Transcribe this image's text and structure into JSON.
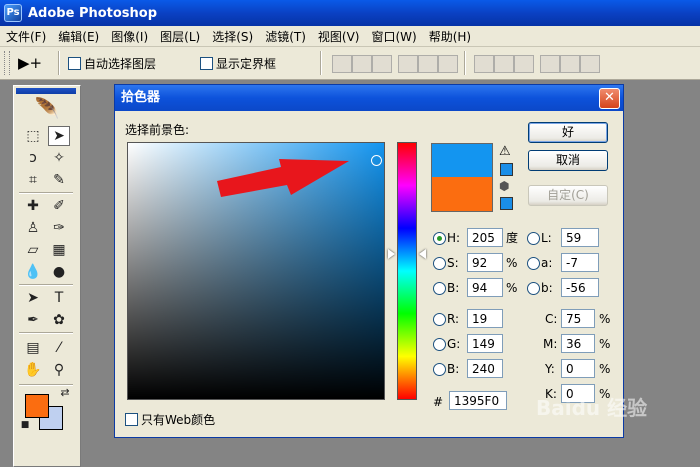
{
  "app": {
    "title": "Adobe Photoshop",
    "menu": [
      "文件(F)",
      "编辑(E)",
      "图像(I)",
      "图层(L)",
      "选择(S)",
      "滤镜(T)",
      "视图(V)",
      "窗口(W)",
      "帮助(H)"
    ]
  },
  "options_bar": {
    "tool_preset": "▶+",
    "auto_select_label": "自动选择图层",
    "show_bounds_label": "显示定界框"
  },
  "toolbox": {
    "foreground_color": "#fb6d10",
    "background_color": "#bfd0f0"
  },
  "picker": {
    "title": "拾色器",
    "close_glyph": "✕",
    "select_label": "选择前景色:",
    "ok_label": "好",
    "cancel_label": "取消",
    "custom_label": "自定(C)",
    "web_only_label": "只有Web颜色",
    "new_color": "#1395f0",
    "old_color": "#fb6d10",
    "hsb": {
      "h_label": "H:",
      "h": "205",
      "h_unit": "度",
      "s_label": "S:",
      "s": "92",
      "s_unit": "%",
      "b_label": "B:",
      "b": "94",
      "b_unit": "%"
    },
    "lab": {
      "l_label": "L:",
      "l": "59",
      "a_label": "a:",
      "a": "-7",
      "b_label": "b:",
      "b": "-56"
    },
    "rgb": {
      "r_label": "R:",
      "r": "19",
      "g_label": "G:",
      "g": "149",
      "b_label": "B:",
      "b": "240"
    },
    "cmyk": {
      "c_label": "C:",
      "c": "75",
      "c_unit": "%",
      "m_label": "M:",
      "m": "36",
      "m_unit": "%",
      "y_label": "Y:",
      "y": "0",
      "y_unit": "%",
      "k_label": "K:",
      "k": "0",
      "k_unit": "%"
    },
    "hex_label": "#",
    "hex": "1395F0"
  },
  "watermark": "Baidu 经验"
}
